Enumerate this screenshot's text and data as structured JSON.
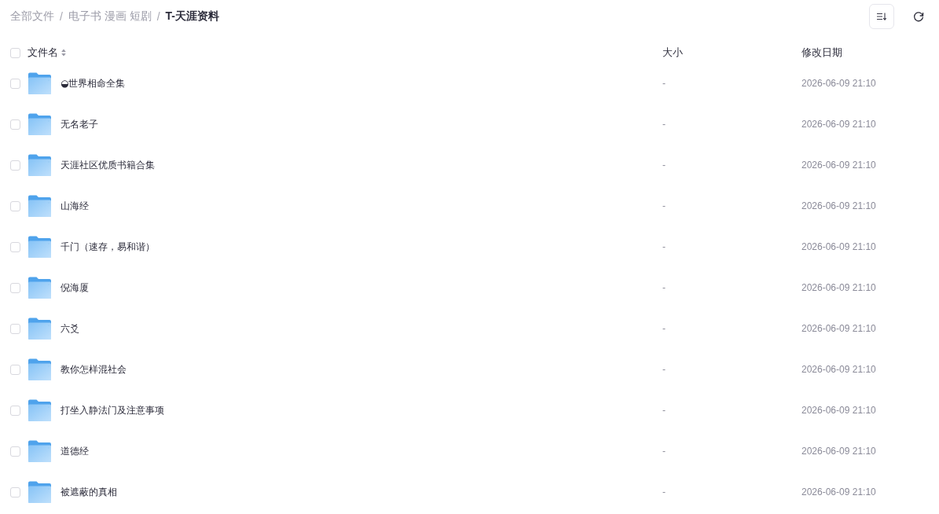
{
  "breadcrumb": [
    {
      "label": "全部文件",
      "current": false
    },
    {
      "separator": "/",
      "label": "电子书 漫画 短剧",
      "current": false
    },
    {
      "separator": "/",
      "label": "T-天涯资料",
      "current": true
    }
  ],
  "table": {
    "select_all": {
      "checked": false
    },
    "columns": [
      {
        "label": "文件名",
        "sortable": true
      },
      {
        "label": "大小",
        "sortable": false
      },
      {
        "label": "修改日期",
        "sortable": false
      }
    ],
    "rows": [
      {
        "name": "◒世界相命全集",
        "size": "-",
        "modified": "2026-06-09 21:10",
        "checked": false
      },
      {
        "name": "无名老子",
        "size": "-",
        "modified": "2026-06-09 21:10",
        "checked": false
      },
      {
        "name": "天涯社区优质书籍合集",
        "size": "-",
        "modified": "2026-06-09 21:10",
        "checked": false
      },
      {
        "name": "山海经",
        "size": "-",
        "modified": "2026-06-09 21:10",
        "checked": false
      },
      {
        "name": "千门（速存，易和谐）",
        "size": "-",
        "modified": "2026-06-09 21:10",
        "checked": false
      },
      {
        "name": "倪海厦",
        "size": "-",
        "modified": "2026-06-09 21:10",
        "checked": false
      },
      {
        "name": "六爻",
        "size": "-",
        "modified": "2026-06-09 21:10",
        "checked": false
      },
      {
        "name": "教你怎样混社会",
        "size": "-",
        "modified": "2026-06-09 21:10",
        "checked": false
      },
      {
        "name": "打坐入静法门及注意事项",
        "size": "-",
        "modified": "2026-06-09 21:10",
        "checked": false
      },
      {
        "name": "道德经",
        "size": "-",
        "modified": "2026-06-09 21:10",
        "checked": false
      },
      {
        "name": "被遮蔽的真相",
        "size": "-",
        "modified": "2026-06-09 21:10",
        "checked": false
      }
    ]
  }
}
